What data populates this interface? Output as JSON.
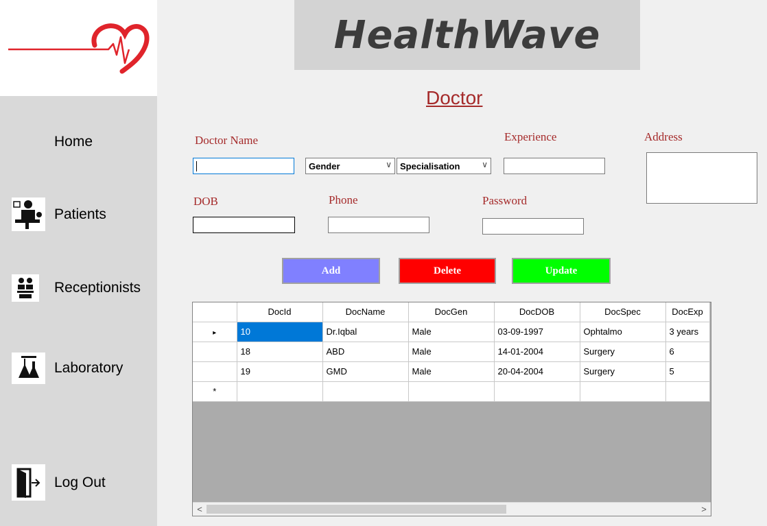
{
  "brand": {
    "name": "HealthWave"
  },
  "colors": {
    "accent_red": "#a52a2a",
    "add": "#8080ff",
    "delete": "#ff0000",
    "update": "#00ff00",
    "logo": "#e0242b"
  },
  "sidebar": {
    "items": [
      {
        "label": "Home",
        "icon": ""
      },
      {
        "label": "Patients",
        "icon": "doctor-patient-icon"
      },
      {
        "label": "Receptionists",
        "icon": "receptionist-icon"
      },
      {
        "label": "Laboratory",
        "icon": "lab-flask-icon"
      },
      {
        "label": "Log Out",
        "icon": "logout-door-icon"
      }
    ]
  },
  "page": {
    "title": "Doctor"
  },
  "form": {
    "doctor_name_label": "Doctor Name",
    "doctor_name_value": "",
    "gender": {
      "selected": "Gender"
    },
    "specialisation": {
      "selected": "Specialisation"
    },
    "experience_label": "Experience",
    "address_label": "Address",
    "dob_label": "DOB",
    "phone_label": "Phone",
    "password_label": "Password"
  },
  "buttons": {
    "add": "Add",
    "delete": "Delete",
    "update": "Update"
  },
  "grid": {
    "columns": [
      "DocId",
      "DocName",
      "DocGen",
      "DocDOB",
      "DocSpec",
      "DocExp"
    ],
    "rows": [
      [
        "10",
        "Dr.Iqbal",
        "Male",
        "03-09-1997",
        "Ophtalmo",
        "3 years"
      ],
      [
        "18",
        "ABD",
        "Male",
        "14-01-2004",
        "Surgery",
        "6"
      ],
      [
        "19",
        "GMD",
        "Male",
        "20-04-2004",
        "Surgery",
        "5"
      ]
    ],
    "current_row_marker": "▸",
    "new_row_marker": "*",
    "scroll_left": "<",
    "scroll_right": ">"
  }
}
